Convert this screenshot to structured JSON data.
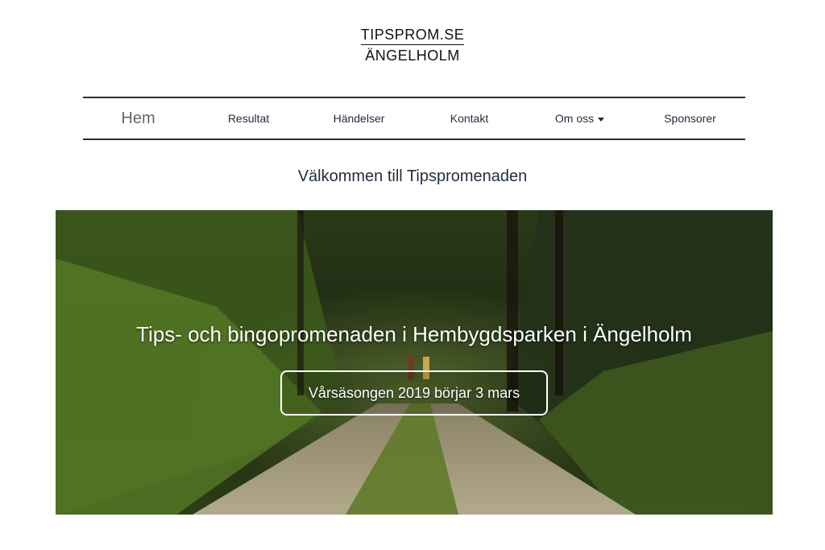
{
  "logo": {
    "line1": "TIPSPROM.SE",
    "line2": "ÄNGELHOLM"
  },
  "nav": {
    "items": [
      {
        "label": "Hem"
      },
      {
        "label": "Resultat"
      },
      {
        "label": "Händelser"
      },
      {
        "label": "Kontakt"
      },
      {
        "label": "Om oss"
      },
      {
        "label": "Sponsorer"
      }
    ]
  },
  "welcome": "Välkommen till Tipspromenaden",
  "hero": {
    "title": "Tips- och bingopromenaden i Hembygdsparken i Ängelholm",
    "button": "Vårsäsongen 2019 börjar 3 mars"
  },
  "colors": {
    "nav_border": "#1e2f45",
    "text": "#1f2d3d",
    "forest_dark": "#1c2412",
    "forest_green": "#4a6a22"
  }
}
